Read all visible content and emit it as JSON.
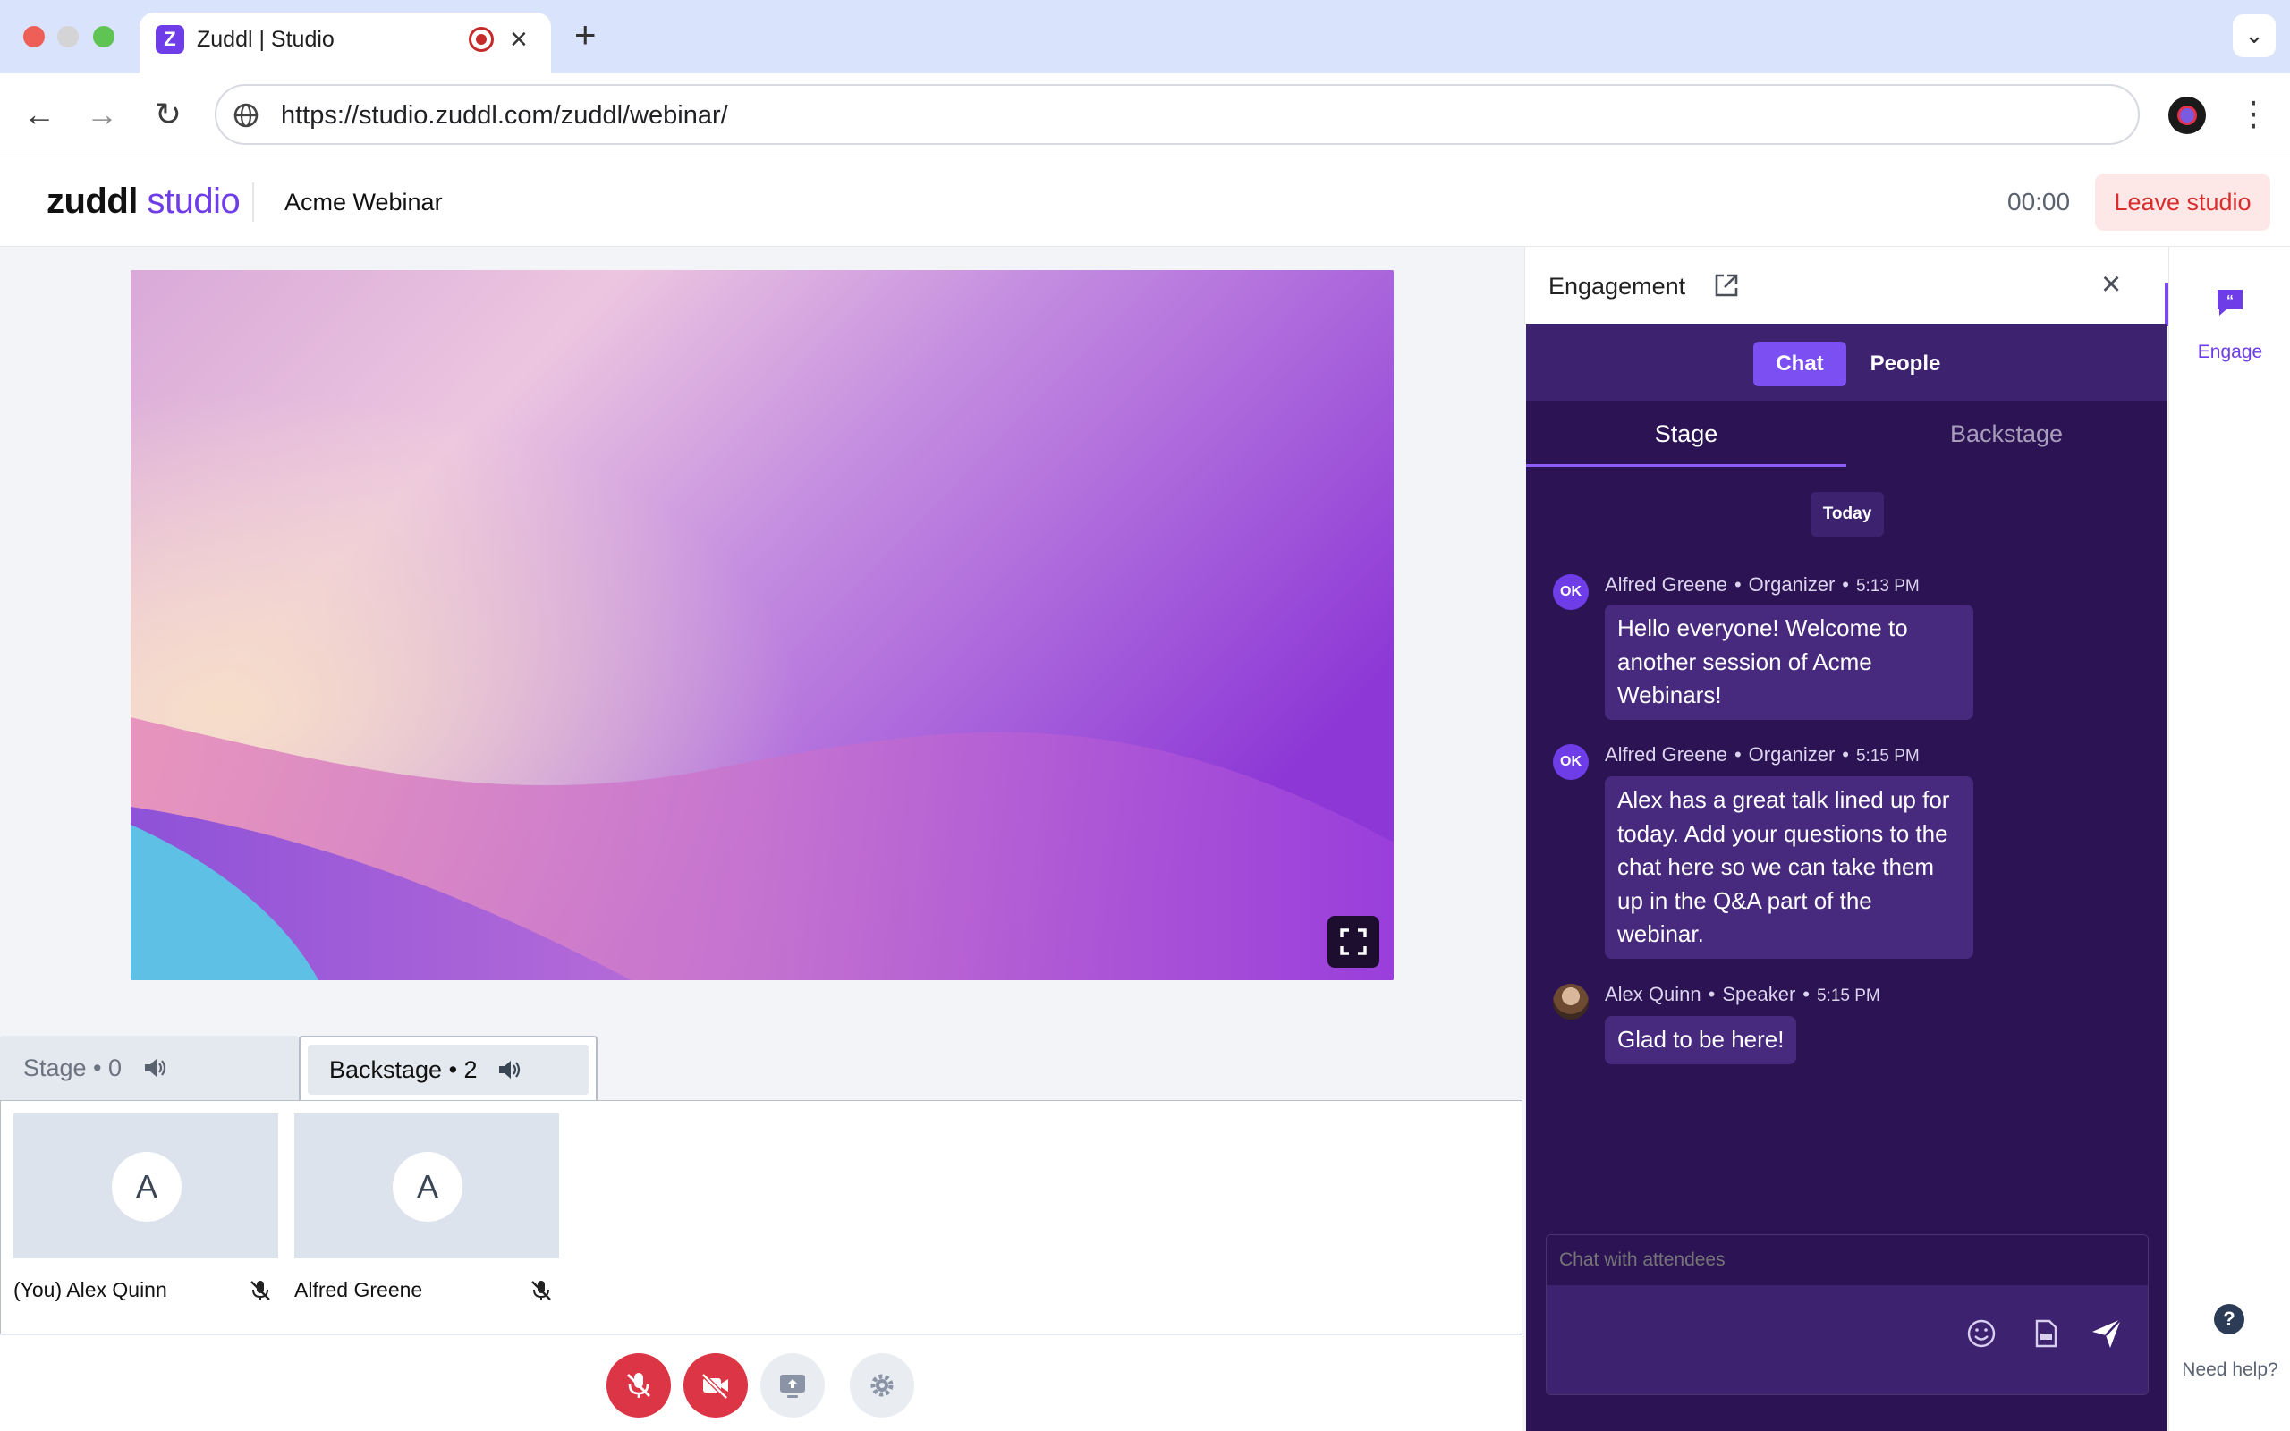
{
  "browser": {
    "tab_title": "Zuddl | Studio",
    "tab_favicon": "Z",
    "url": "https://studio.zuddl.com/zuddl/webinar/"
  },
  "header": {
    "brand_primary": "zuddl",
    "brand_secondary": "studio",
    "event_title": "Acme Webinar",
    "timer": "00:00",
    "leave_label": "Leave studio"
  },
  "participants": {
    "tabs": [
      {
        "label": "Stage • 0"
      },
      {
        "label": "Backstage • 2"
      }
    ],
    "tiles": [
      {
        "initial": "A",
        "name": "(You) Alex Quinn"
      },
      {
        "initial": "A",
        "name": "Alfred Greene"
      }
    ]
  },
  "engagement": {
    "title": "Engagement",
    "segments": [
      "Chat",
      "People"
    ],
    "subtabs": [
      "Stage",
      "Backstage"
    ],
    "date_divider": "Today",
    "messages": [
      {
        "avatar": "OK",
        "author": "Alfred Greene",
        "role": "Organizer",
        "time": "5:13 PM",
        "text": "Hello everyone! Welcome to another session of Acme Webinars!"
      },
      {
        "avatar": "OK",
        "author": "Alfred Greene",
        "role": "Organizer",
        "time": "5:15 PM",
        "text": "Alex has a great talk lined up for today. Add your questions to the chat here so we can take them up in the Q&A part of the webinar."
      },
      {
        "avatar": "",
        "author": "Alex Quinn",
        "role": "Speaker",
        "time": "5:15 PM",
        "text": "Glad to be here!"
      }
    ],
    "composer_placeholder": "Chat with attendees"
  },
  "rail": {
    "engage_label": "Engage",
    "help_label": "Need help?"
  },
  "colors": {
    "brand": "#6f3de8",
    "panel_bg": "#2c1454",
    "danger": "#dc3545"
  }
}
